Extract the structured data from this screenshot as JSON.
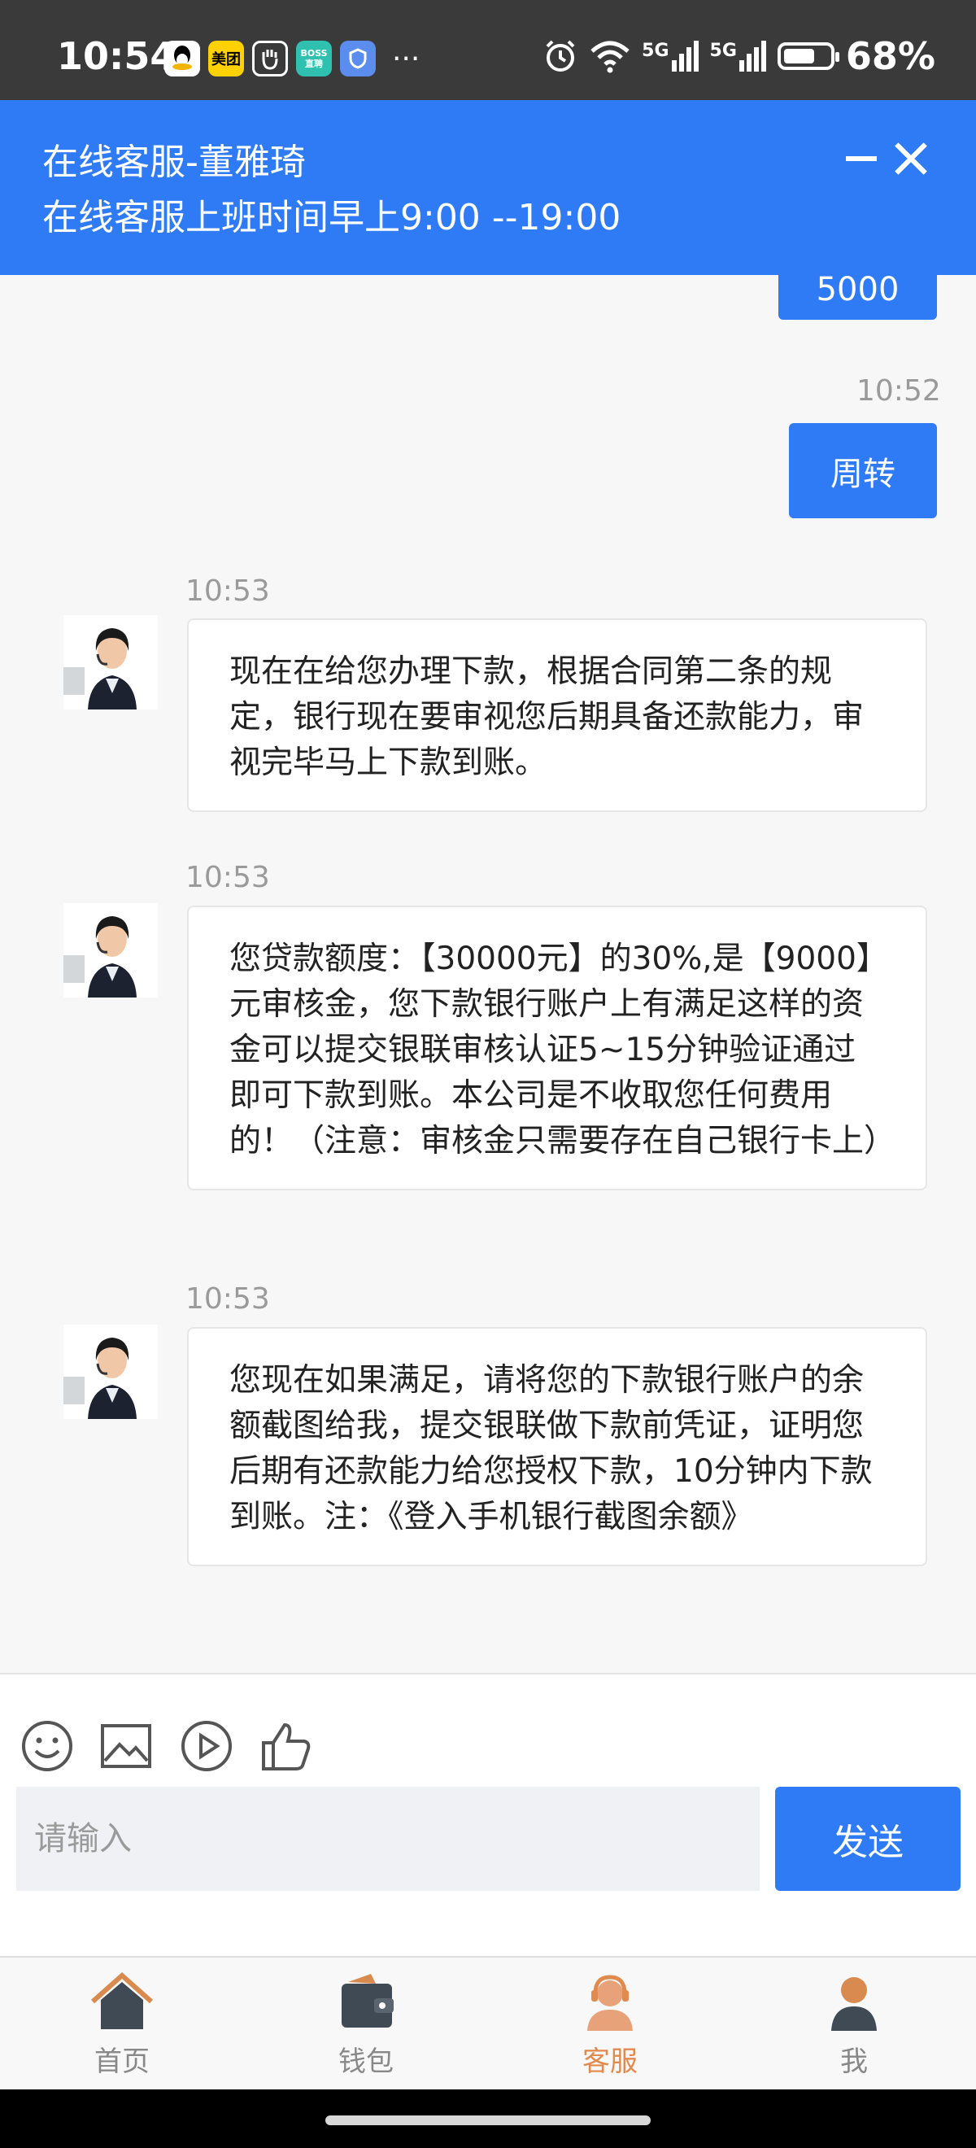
{
  "status_bar": {
    "time": "10:54",
    "apps": [
      {
        "icon": "qq-icon",
        "label": "",
        "color": "#ffffff"
      },
      {
        "icon": "meituan-icon",
        "label": "美团",
        "color": "#ffd100"
      },
      {
        "icon": "hand-icon",
        "label": "",
        "color": "#ffffff"
      },
      {
        "icon": "boss-icon",
        "label": "BOSS直聘",
        "color": "#2fc0b0"
      },
      {
        "icon": "shield-app-icon",
        "label": "",
        "color": "#5b8def"
      }
    ],
    "more": "···",
    "network_1": "5G",
    "network_2": "5G",
    "battery_percent": "68%",
    "battery_level": 0.68
  },
  "header": {
    "title": "在线客服-董雅琦",
    "subtitle": "在线客服上班时间早上9:00 --19:00"
  },
  "messages": {
    "partial_user_text": "5000",
    "user_time": "10:52",
    "user_text": "周转",
    "agent": [
      {
        "time": "10:53",
        "text": "现在在给您办理下款，根据合同第二条的规定，银行现在要审视您后期具备还款能力，审视完毕马上下款到账。"
      },
      {
        "time": "10:53",
        "text": "您贷款额度：【30000元】的30%,是【9000】元审核金，您下款银行账户上有满足这样的资金可以提交银联审核认证5~15分钟验证通过即可下款到账。本公司是不收取您任何费用的！（注意：审核金只需要存在自己银行卡上）"
      },
      {
        "time": "10:53",
        "text": "您现在如果满足，请将您的下款银行账户的余额截图给我，提交银联做下款前凭证，证明您后期有还款能力给您授权下款，10分钟内下款到账。注：《登入手机银行截图余额》"
      }
    ]
  },
  "composer": {
    "placeholder": "请输入",
    "send_label": "发送"
  },
  "nav": {
    "items": [
      {
        "label": "首页",
        "icon": "home-icon"
      },
      {
        "label": "钱包",
        "icon": "wallet-icon"
      },
      {
        "label": "客服",
        "icon": "customer-service-icon",
        "active": true
      },
      {
        "label": "我",
        "icon": "user-icon"
      }
    ]
  },
  "colors": {
    "accent": "#2f7bf5",
    "active_nav": "#e08a4e"
  }
}
